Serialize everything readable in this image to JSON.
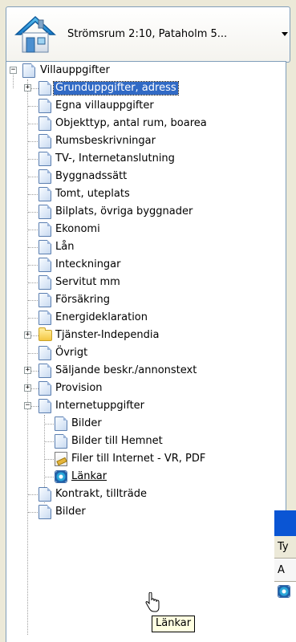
{
  "property_selector": {
    "label": "Strömsrum 2:10, Pataholm 5...",
    "icon": "house-icon"
  },
  "tree": {
    "root": "Villauppgifter",
    "items": [
      {
        "label": "Grunduppgifter, adress",
        "icon": "document-icon",
        "expandable": true,
        "selected": true
      },
      {
        "label": "Egna villauppgifter",
        "icon": "document-icon"
      },
      {
        "label": "Objekttyp, antal rum, boarea",
        "icon": "document-icon"
      },
      {
        "label": "Rumsbeskrivningar",
        "icon": "document-icon"
      },
      {
        "label": "TV-, Internetanslutning",
        "icon": "document-icon"
      },
      {
        "label": "Byggnadssätt",
        "icon": "document-icon"
      },
      {
        "label": "Tomt, uteplats",
        "icon": "document-icon"
      },
      {
        "label": "Bilplats, övriga byggnader",
        "icon": "document-icon"
      },
      {
        "label": "Ekonomi",
        "icon": "document-icon"
      },
      {
        "label": "Lån",
        "icon": "document-icon"
      },
      {
        "label": "Inteckningar",
        "icon": "document-icon"
      },
      {
        "label": "Servitut mm",
        "icon": "document-icon"
      },
      {
        "label": "Försäkring",
        "icon": "document-icon"
      },
      {
        "label": "Energideklaration",
        "icon": "document-icon"
      },
      {
        "label": "Tjänster-Independia",
        "icon": "folder-icon",
        "expandable": true
      },
      {
        "label": "Övrigt",
        "icon": "document-icon"
      },
      {
        "label": "Säljande beskr./annonstext",
        "icon": "document-icon",
        "expandable": true
      },
      {
        "label": "Provision",
        "icon": "document-icon",
        "expandable": true
      },
      {
        "label": "Internetuppgifter",
        "icon": "document-icon",
        "expanded": true
      },
      {
        "label": "Kontrakt, tillträde",
        "icon": "document-icon"
      },
      {
        "label": "Bilder",
        "icon": "document-icon"
      }
    ],
    "internet_children": [
      {
        "label": "Bilder",
        "icon": "document-icon"
      },
      {
        "label": "Bilder till Hemnet",
        "icon": "document-icon"
      },
      {
        "label": "Filer till Internet - VR, PDF",
        "icon": "file-edit-icon"
      },
      {
        "label": "Länkar",
        "icon": "globe-icon",
        "hover": true
      }
    ]
  },
  "background_window": {
    "row1": "Ty",
    "row2": "A"
  },
  "tooltip": "Länkar",
  "colors": {
    "selection": "#316ac5",
    "title_bar": "#0a55d4",
    "tooltip_bg": "#ffffe1"
  }
}
